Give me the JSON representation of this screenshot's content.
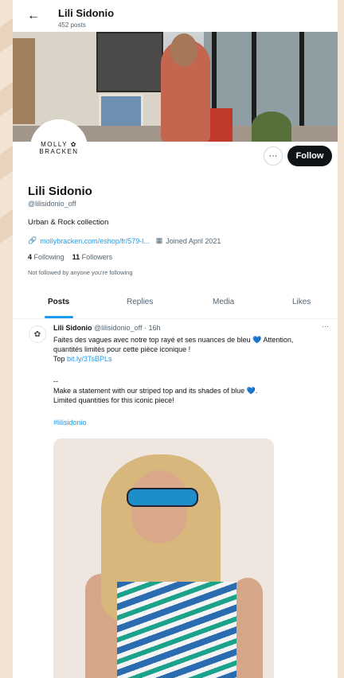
{
  "header": {
    "title": "Lili Sidonio",
    "posts_count": "452 posts",
    "back_icon": "back-arrow-icon"
  },
  "profile": {
    "logo_line1": "MOLLY ✿",
    "logo_line2": "BRACKEN",
    "name": "Lili Sidonio",
    "handle": "@lilisidonio_off",
    "bio": "Urban & Rock collection",
    "link": "mollybracken.com/eshop/fr/579-l...",
    "joined": "Joined April 2021",
    "following_count": "4",
    "following_label": "Following",
    "followers_count": "11",
    "followers_label": "Followers",
    "not_followed": "Not followed by anyone you're following",
    "more_label": "···",
    "follow_label": "Follow"
  },
  "tabs": [
    "Posts",
    "Replies",
    "Media",
    "Likes"
  ],
  "tweet": {
    "name": "Lili Sidonio",
    "meta": "@lilisidonio_off · 16h",
    "more": "···",
    "text1_line1": "Faites des vagues avec notre top rayé et ses nuances de bleu 💙 Attention,",
    "text1_line2": "quantités limités pour cette pièce iconique !",
    "top_label": "Top",
    "top_link": "bit.ly/3TsBPLs",
    "dash": "--",
    "text2_line1": "Make a statement with our striped top  and its shades of blue 💙.",
    "text2_line2": "Limited quantities for this iconic piece!",
    "hashtag": "#lilisidonio"
  },
  "colors": {
    "accent": "#1d9bf0",
    "dark": "#0f1419",
    "muted": "#536471",
    "page_bg": "#f2e3d3"
  }
}
